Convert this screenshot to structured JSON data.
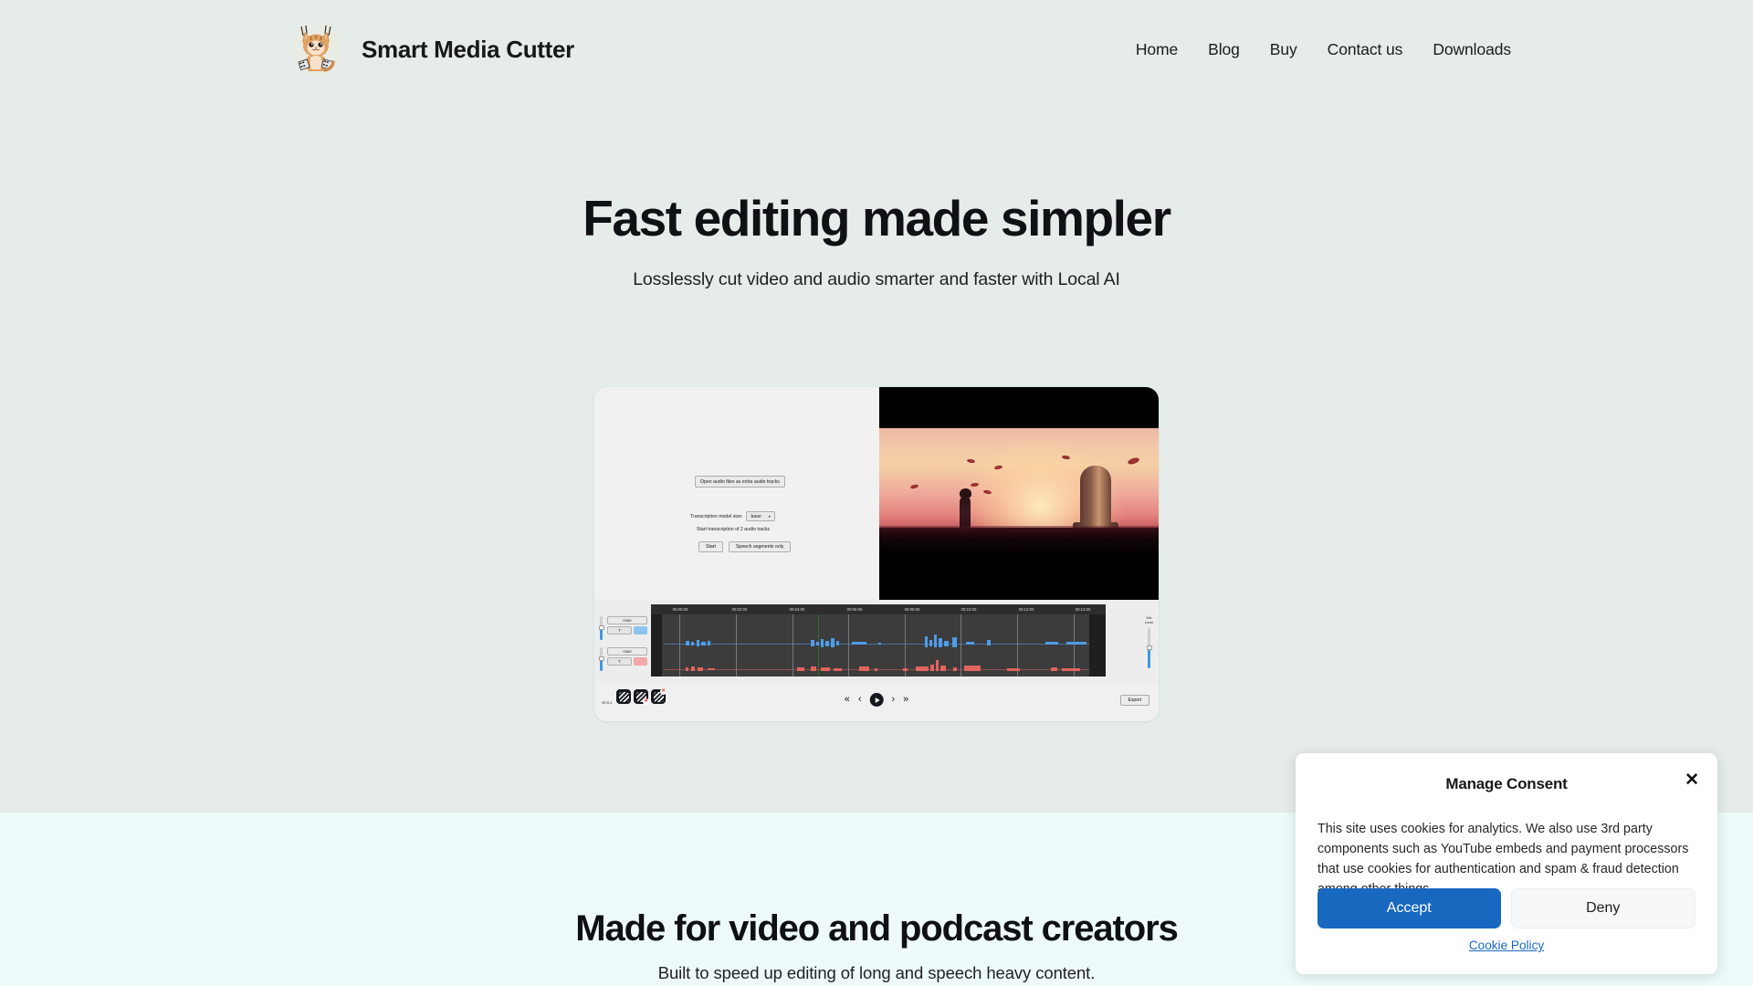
{
  "header": {
    "brand_name": "Smart Media Cutter",
    "logo_icon": "lynx-mascot-logo",
    "nav": [
      {
        "label": "Home"
      },
      {
        "label": "Blog"
      },
      {
        "label": "Buy"
      },
      {
        "label": "Contact us"
      },
      {
        "label": "Downloads"
      }
    ]
  },
  "hero": {
    "title": "Fast editing made simpler",
    "subtitle": "Losslessly cut video and audio smarter and faster with Local AI",
    "background_color": "#e5ecea"
  },
  "app_screenshot": {
    "controls": {
      "open_audio_button": "Open audio files as extra audio tracks",
      "model_size_label": "Transcription model size:",
      "model_size_value": "base",
      "transcribe_label": "Start transcription of 2 audio tracks",
      "start_button": "Start",
      "speech_only_button": "Speech segments only"
    },
    "timeline": {
      "ticks": [
        "00:00:00",
        "00:02:00",
        "00:04:00",
        "00:06:00",
        "00:08:00",
        "00:10:00",
        "00:12:00",
        "00:14:00"
      ],
      "tracks": [
        {
          "mute_label": "mute",
          "t_label": "T",
          "color": "#8cc4f0",
          "waveform_color": "#4f9ce8"
        },
        {
          "mute_label": "mute",
          "t_label": "T",
          "color": "#f0a8a8",
          "waveform_color": "#e2645f"
        }
      ],
      "mix_level_label": "Mix Level"
    },
    "bottom_bar": {
      "version": "v0.0.1",
      "tool_icons": [
        "film-strip-icon",
        "film-strip-cut-icon",
        "film-strip-delete-icon"
      ],
      "transport": [
        {
          "icon": "skip-back-icon",
          "glyph": "«"
        },
        {
          "icon": "step-back-icon",
          "glyph": "‹"
        },
        {
          "icon": "play-icon",
          "glyph": "▶"
        },
        {
          "icon": "step-forward-icon",
          "glyph": "›"
        },
        {
          "icon": "skip-forward-icon",
          "glyph": "»"
        }
      ],
      "export_button": "Export"
    }
  },
  "section_two": {
    "title": "Made for video and podcast creators",
    "subtitle": "Built to speed up editing of long and speech heavy content.",
    "background_color": "#eefaf9"
  },
  "consent": {
    "title": "Manage Consent",
    "close_icon": "✕",
    "body": "This site uses cookies for analytics. We also use 3rd party components such as YouTube embeds and payment processors that use cookies for authentication and spam & fraud detection among other things.",
    "accept_label": "Accept",
    "deny_label": "Deny",
    "policy_link": "Cookie Policy",
    "accept_color": "#1868c0"
  }
}
